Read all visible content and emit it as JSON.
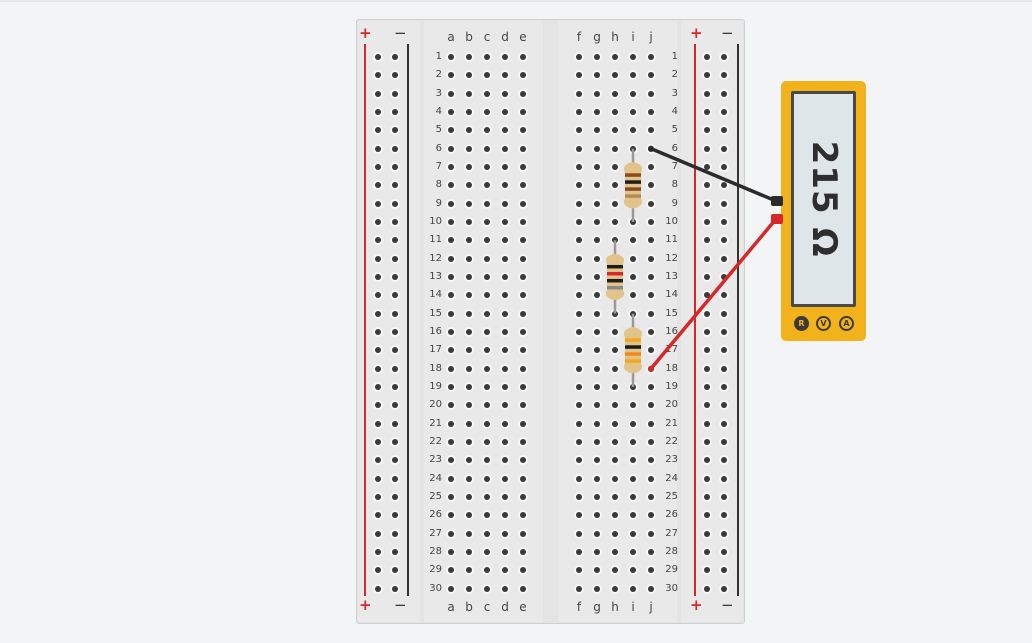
{
  "breadboard": {
    "power_rail": {
      "plus": "+",
      "minus": "−",
      "plus_color": "#d62828",
      "minus_color": "#333333"
    },
    "columns_left": [
      "a",
      "b",
      "c",
      "d",
      "e"
    ],
    "columns_right": [
      "f",
      "g",
      "h",
      "i",
      "j"
    ],
    "rows": 30
  },
  "resistors": [
    {
      "name": "resistor-1",
      "column": "i",
      "from_row": 6,
      "to_row": 10,
      "bands": [
        "#8b4a1c",
        "#1e1e1e",
        "#8b4a1c",
        "#b08d57"
      ]
    },
    {
      "name": "resistor-2",
      "column": "h",
      "from_row": 11,
      "to_row": 15,
      "bands": [
        "#1e1e1e",
        "#d62828",
        "#1e1e1e",
        "#8a8a8a"
      ]
    },
    {
      "name": "resistor-3",
      "column": "i",
      "from_row": 15,
      "to_row": 19,
      "bands": [
        "#f2a81d",
        "#1e1e1e",
        "#f08a1c",
        "#f2a81d"
      ]
    }
  ],
  "multimeter": {
    "reading": "215 Ω",
    "modes": [
      "R",
      "V",
      "A"
    ],
    "active_mode": "R",
    "body_color": "#f2b21c"
  },
  "probes": [
    {
      "name": "black-probe-wire",
      "color": "#2b2b2b",
      "column": "j",
      "row": 6,
      "port": "com"
    },
    {
      "name": "red-probe-wire",
      "color": "#d62828",
      "column": "j",
      "row": 18,
      "port": "ohm"
    }
  ]
}
